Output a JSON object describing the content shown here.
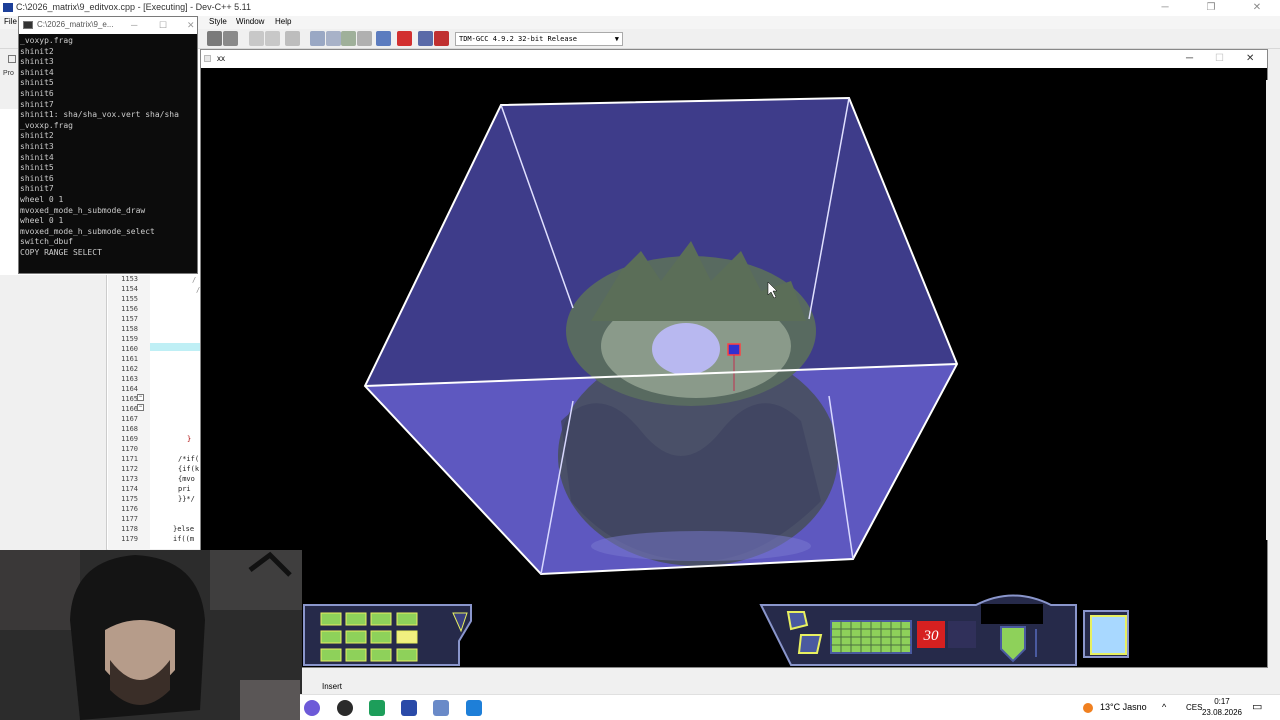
{
  "devcpp": {
    "title": "C:\\2026_matrix\\9_editvox.cpp - [Executing] - Dev-C++ 5.11",
    "menu": {
      "file": "File",
      "style": "Style",
      "window": "Window",
      "help": "Help"
    },
    "compiler": "TDM-GCC 4.9.2 32-bit Release",
    "side_tab_label": "Pro",
    "line_numbers": [
      "1153",
      "1154",
      "1155",
      "1156",
      "1157",
      "1158",
      "1159",
      "1160",
      "1161",
      "1162",
      "1163",
      "1164",
      "1165",
      "1166",
      "1167",
      "1168",
      "1169",
      "1170",
      "1171",
      "1172",
      "1173",
      "1174",
      "1175",
      "1176",
      "1177",
      "1178",
      "1179"
    ],
    "code": {
      "l1171": "/*if(",
      "l1172": "{if(k",
      "l1173": " {mvo",
      "l1174": "  pri",
      "l1175": "}}*/",
      "l1178": "}else",
      "l1179": "if((m",
      "l1169": "}"
    },
    "status": "Insert"
  },
  "console": {
    "title": "C:\\2026_matrix\\9_e...",
    "lines": [
      "_voxyp.frag",
      "shinit2",
      "shinit3",
      "shinit4",
      "shinit5",
      "shinit6",
      "shinit7",
      "shinit1: sha/sha_vox.vert sha/sha",
      "_voxxp.frag",
      "shinit2",
      "shinit3",
      "shinit4",
      "shinit5",
      "shinit6",
      "shinit7",
      "wheel 0 1",
      "mvoxed_mode_h_submode_draw",
      "wheel 0 1",
      "mvoxed_mode_h_submode_select",
      "switch_dbuf",
      "COPY RANGE SELECT"
    ]
  },
  "xx_window": {
    "title": "xx",
    "hud_counter": "30"
  },
  "taskbar": {
    "weather": "13°C Jasno",
    "language": "CES",
    "time": "0:17",
    "date": "23.08.2026"
  },
  "colors": {
    "cube_top": "#3e3c8a",
    "cube_bottom": "#5e58c0",
    "hud_frame": "#8a96cc",
    "hud_green": "#8ed15a",
    "hud_yellow": "#e8f060",
    "counter_red": "#d62020"
  }
}
